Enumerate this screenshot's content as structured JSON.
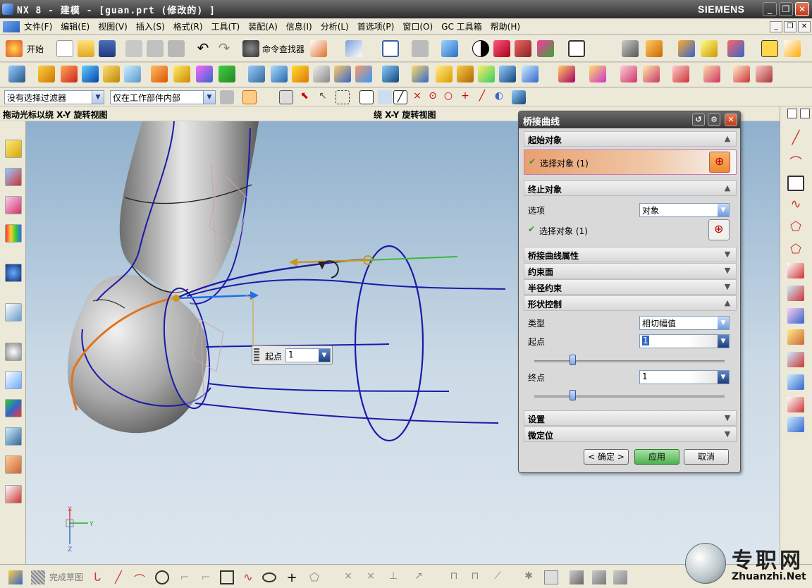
{
  "window": {
    "title": "NX 8 - 建模 - [guan.prt  (修改的) ]",
    "brand": "SIEMENS",
    "controls": [
      "_",
      "❐",
      "✕"
    ]
  },
  "menu": [
    "文件(F)",
    "编辑(E)",
    "视图(V)",
    "插入(S)",
    "格式(R)",
    "工具(T)",
    "装配(A)",
    "信息(I)",
    "分析(L)",
    "首选项(P)",
    "窗口(O)",
    "GC 工具箱",
    "帮助(H)"
  ],
  "toolbar": {
    "start_label": "开始",
    "command_finder_label": "命令查找器"
  },
  "filters": {
    "selection_filter": "没有选择过滤器",
    "scope": "仅在工作部件内部"
  },
  "hints": {
    "left": "拖动光标以绕 X-Y 旋转视图",
    "right": "绕 X-Y 旋转视图"
  },
  "viewport": {
    "handle_label": "起点",
    "handle_value": "1"
  },
  "dialog": {
    "title": "桥接曲线",
    "sections": {
      "start_object": "起始对象",
      "end_object": "终止对象",
      "properties": "桥接曲线属性",
      "constraint_face": "约束面",
      "radius_constraint": "半径约束",
      "shape_control": "形状控制",
      "settings": "设置",
      "fine_position": "微定位"
    },
    "start_select": "选择对象 (1)",
    "end_option_label": "选项",
    "end_option_value": "对象",
    "end_select": "选择对象 (1)",
    "type_label": "类型",
    "type_value": "相切幅值",
    "start_label": "起点",
    "start_value": "1",
    "end_label": "终点",
    "end_value": "1",
    "buttons": {
      "ok": "< 确定 >",
      "apply": "应用",
      "cancel": "取消"
    }
  },
  "bottom": {
    "finish_sketch": "完成草图"
  },
  "watermark": {
    "cn": "专职网",
    "url": "Zhuanzhi.Net"
  },
  "colors": {
    "curve_blue": "#1a1aa8",
    "highlight_orange": "#e0751e",
    "apply_green": "#5fbf5f",
    "selection_orange": "#e8a070"
  }
}
